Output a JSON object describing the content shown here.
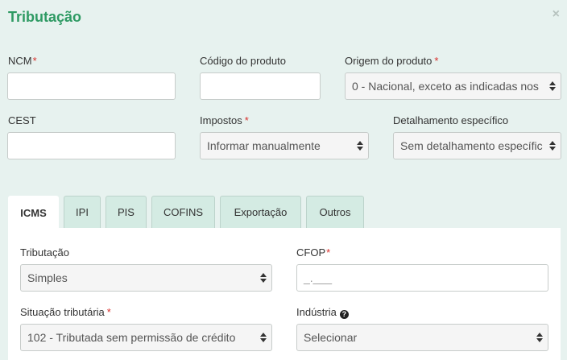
{
  "dialog": {
    "title": "Tributação",
    "close": "×"
  },
  "form": {
    "ncm": {
      "label": "NCM",
      "required": "*",
      "value": ""
    },
    "codigo_produto": {
      "label": "Código do produto",
      "value": ""
    },
    "origem": {
      "label": "Origem do produto",
      "required": "*",
      "selected": "0 - Nacional, exceto as indicadas nos"
    },
    "cest": {
      "label": "CEST",
      "value": ""
    },
    "impostos": {
      "label": "Impostos",
      "required": "*",
      "selected": "Informar manualmente"
    },
    "detalhamento": {
      "label": "Detalhamento específico",
      "selected": "Sem detalhamento específico"
    }
  },
  "tabs": [
    {
      "label": "ICMS",
      "active": true
    },
    {
      "label": "IPI",
      "active": false
    },
    {
      "label": "PIS",
      "active": false
    },
    {
      "label": "COFINS",
      "active": false
    },
    {
      "label": "Exportação",
      "active": false
    },
    {
      "label": "Outros",
      "active": false
    }
  ],
  "icms": {
    "tributacao": {
      "label": "Tributação",
      "selected": "Simples"
    },
    "cfop": {
      "label": "CFOP",
      "required": "*",
      "placeholder": "_.___"
    },
    "situacao": {
      "label": "Situação tributária",
      "required": "*",
      "selected": "102 - Tributada sem permissão de crédito"
    },
    "industria": {
      "label": "Indústria",
      "help_icon": "question-circle-icon",
      "selected": "Selecionar"
    }
  },
  "colors": {
    "title": "#2e9a63",
    "required": "#d9302c",
    "background": "#e7f2ef",
    "tab_inactive": "#d4ebe3"
  }
}
